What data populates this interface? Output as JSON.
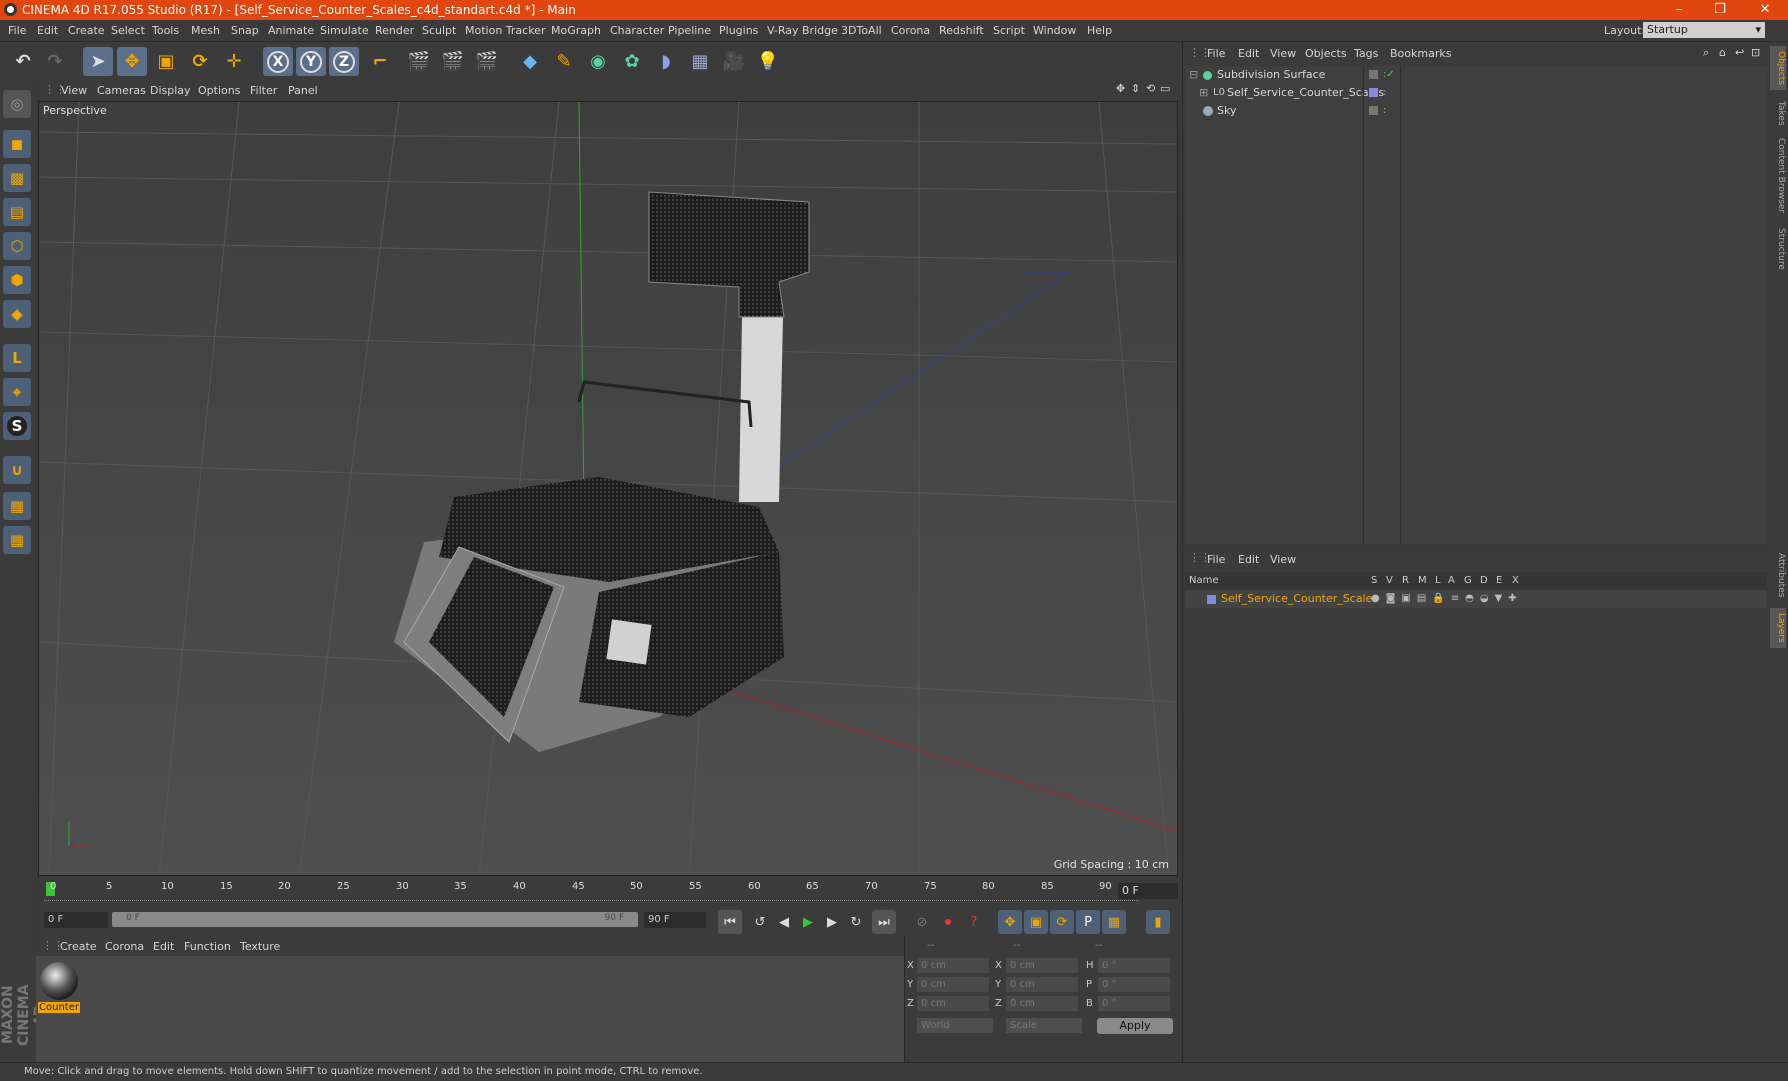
{
  "window": {
    "title": "CINEMA 4D R17.055 Studio (R17) - [Self_Service_Counter_Scales_c4d_standart.c4d *] - Main",
    "controls": [
      "–",
      "❐",
      "✕"
    ]
  },
  "menu": {
    "items": [
      "File",
      "Edit",
      "Create",
      "Select",
      "Tools",
      "Mesh",
      "Snap",
      "Animate",
      "Simulate",
      "Render",
      "Sculpt",
      "Motion Tracker",
      "MoGraph",
      "Character",
      "Pipeline",
      "Plugins",
      "V-Ray Bridge",
      "3DToAll",
      "Corona",
      "Redshift",
      "Script",
      "Window",
      "Help"
    ],
    "layout_label": "Layout:",
    "layout_value": "Startup"
  },
  "toolbar": {
    "axis_x": "X",
    "axis_y": "Y",
    "axis_z": "Z"
  },
  "viewport": {
    "menu": [
      "View",
      "Cameras",
      "Display",
      "Options",
      "Filter",
      "Panel"
    ],
    "camera_label": "Perspective",
    "grid_spacing": "Grid Spacing : 10 cm"
  },
  "timeline": {
    "ticks": [
      "0",
      "5",
      "10",
      "15",
      "20",
      "25",
      "30",
      "35",
      "40",
      "45",
      "50",
      "55",
      "60",
      "65",
      "70",
      "75",
      "80",
      "85",
      "90"
    ],
    "current_frame": "0 F"
  },
  "transport": {
    "start_field": "0 F",
    "slider_start": "0 F",
    "slider_end": "90 F",
    "end_field": "90 F"
  },
  "material_manager": {
    "menu": [
      "Create",
      "Corona",
      "Edit",
      "Function",
      "Texture"
    ],
    "materials": [
      {
        "name": "Counter"
      }
    ]
  },
  "coordinates": {
    "header": [
      "--",
      "--",
      "--"
    ],
    "rows": [
      {
        "a_label": "X",
        "a_value": "0 cm",
        "b_label": "X",
        "b_value": "0 cm",
        "c_label": "H",
        "c_value": "0 °"
      },
      {
        "a_label": "Y",
        "a_value": "0 cm",
        "b_label": "Y",
        "b_value": "0 cm",
        "c_label": "P",
        "c_value": "0 °"
      },
      {
        "a_label": "Z",
        "a_value": "0 cm",
        "b_label": "Z",
        "b_value": "0 cm",
        "c_label": "B",
        "c_value": "0 °"
      }
    ],
    "mode_world": "World",
    "mode_scale": "Scale",
    "apply_label": "Apply"
  },
  "object_manager": {
    "menu": [
      "File",
      "Edit",
      "View",
      "Objects",
      "Tags",
      "Bookmarks"
    ],
    "objects": [
      {
        "name": "Subdivision Surface"
      },
      {
        "name": "Self_Service_Counter_Scales"
      },
      {
        "name": "Sky"
      }
    ]
  },
  "layer_manager": {
    "menu": [
      "File",
      "Edit",
      "View"
    ],
    "columns": [
      "Name",
      "S",
      "V",
      "R",
      "M",
      "L",
      "A",
      "G",
      "D",
      "E",
      "X"
    ],
    "layers": [
      {
        "name": "Self_Service_Counter_Scales"
      }
    ]
  },
  "side_tabs": [
    "Objects",
    "Takes",
    "Content Browser",
    "Structure",
    "Attributes",
    "Layers"
  ],
  "status": "Move: Click and drag to move elements. Hold down SHIFT to quantize movement / add to the selection in point mode, CTRL to remove.",
  "branding": "MAXON CINEMA 4D",
  "colors": {
    "title_bar": "#e2460f",
    "accent": "#f0a500",
    "selection": "#5c6f8a"
  }
}
